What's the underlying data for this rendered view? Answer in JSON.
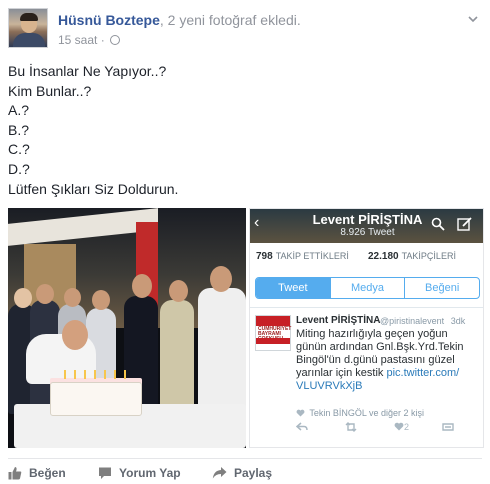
{
  "post": {
    "author": "Hüsnü Boztepe",
    "activity": ", 2 yeni fotoğraf ekledi.",
    "time": "15 saat",
    "separator": "·",
    "text_lines": [
      "Bu İnsanlar Ne Yapıyor..?",
      "Kim Bunlar..?",
      "A.?",
      "B.?",
      "C.?",
      "D.?",
      "Lütfen Şıkları Siz Doldurun."
    ]
  },
  "twitter": {
    "name": "Levent PİRİŞTİNA",
    "tweets_count": "8.926 Tweet",
    "following_count": "798",
    "following_label": "TAKİP ETTİKLERİ",
    "followers_count": "22.180",
    "followers_label": "TAKİPÇİLERİ",
    "tabs": [
      "Tweet",
      "Medya",
      "Beğeni"
    ],
    "tweet": {
      "user": "Levent PİRİŞTİNA",
      "handle": "@piristinalevent",
      "age": "3dk",
      "lines": [
        "Miting hazırlığıyla geçen yoğun",
        "günün ardından Gnl.Bşk.Yrd.Tekin",
        "Bingöl'ün d.günü pastasını güzel",
        "yarınlar için kestik"
      ],
      "link_1": "pic.twitter.com/",
      "link_2": "VLUVRVkXjB",
      "retweet_note": "Tekin BİNGÖL ve diğer 2 kişi",
      "likes": "2",
      "avatar_text_1": "CUMHURİYET",
      "avatar_text_2": "BAYRAMI",
      "avatar_text_3": "COŞKUSU"
    }
  },
  "actions": {
    "like": "Beğen",
    "comment": "Yorum Yap",
    "share": "Paylaş"
  },
  "colors": {
    "link_blue": "#365899",
    "meta_gray": "#90949c",
    "twitter_blue": "#55acee"
  },
  "icons": [
    "globe-icon",
    "chevron-down-icon",
    "like-icon",
    "comment-icon",
    "share-icon",
    "back-arrow-icon",
    "search-icon",
    "compose-icon",
    "retweet-icon",
    "reply-icon",
    "heart-icon",
    "more-icon"
  ]
}
